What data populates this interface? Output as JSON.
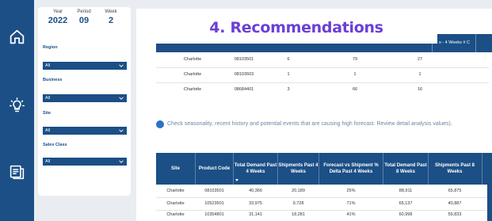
{
  "sidebar": {
    "icons": [
      "home-icon",
      "lightbulb-icon",
      "report-icon"
    ]
  },
  "filters": {
    "year": {
      "label": "Year",
      "value": "2022"
    },
    "period": {
      "label": "Period",
      "value": "09"
    },
    "week": {
      "label": "Week",
      "value": "2"
    },
    "region": {
      "label": "Region",
      "value": "All"
    },
    "business": {
      "label": "Business",
      "value": "All"
    },
    "site": {
      "label": "Site",
      "value": "All"
    },
    "sales_class": {
      "label": "Sales Class",
      "value": "All"
    }
  },
  "title": "4. Recommendations",
  "table1": {
    "header_peek": "s - 4 Weeks   # C",
    "rows": [
      [
        "Charlotte",
        "08103501",
        "6",
        "79",
        "27"
      ],
      [
        "Charlotte",
        "08103603",
        "1",
        "1",
        "1"
      ],
      [
        "Charlotte",
        "08684401",
        "3",
        "66",
        "16"
      ]
    ]
  },
  "note": "Check seasonality, recent history and potential events that are causing high forecast. Review detail analysis values).",
  "table2": {
    "headers": [
      "Site",
      "Product Code",
      "Total Demand Past 4 Weeks",
      "Shipments Past 4 Weeks",
      "Forecast vs Shipment % Delta Past 4 Weeks",
      "Total Demand Past 8 Weeks",
      "Shipments Past 8 Weeks"
    ],
    "rows": [
      [
        "Charlotte",
        "08103501",
        "40,366",
        "20,189",
        "25%",
        "88,911",
        "65,875"
      ],
      [
        "Charlotte",
        "10523501",
        "33,975",
        "9,728",
        "71%",
        "65,137",
        "40,887"
      ],
      [
        "Charlotte",
        "10354801",
        "31,141",
        "18,281",
        "41%",
        "60,998",
        "59,833"
      ]
    ]
  },
  "colors": {
    "brand": "#1b4f86",
    "title": "#6a3fd6",
    "note": "#6e86a6",
    "dot": "#2a72c8"
  }
}
